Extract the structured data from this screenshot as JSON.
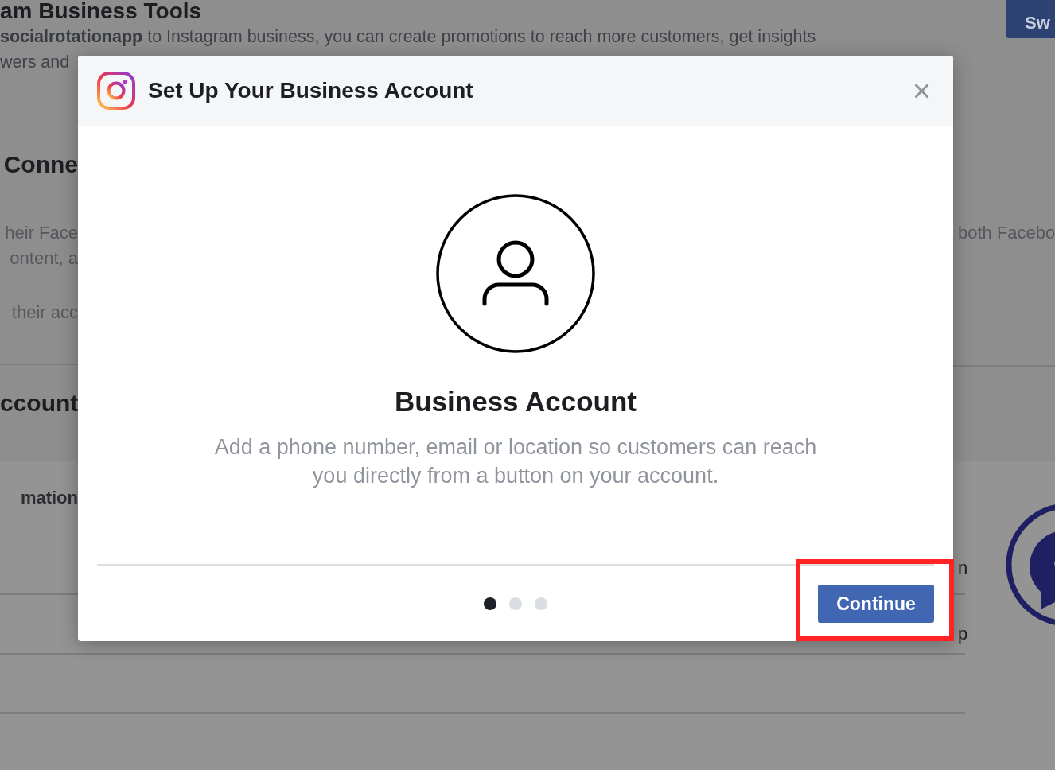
{
  "background": {
    "heading": "am Business Tools",
    "intro": [
      "**socialrotationapp** to Instagram business, you can create promotions to reach more customers, get insights",
      "wers and"
    ],
    "switch_button": "Sw",
    "left_fragments": [
      {
        "kind": "heading",
        "text": "Conne"
      },
      {
        "kind": "text",
        "text": "heir Face"
      },
      {
        "kind": "text",
        "text": "ontent, a"
      },
      {
        "kind": "text",
        "text": "their acc"
      },
      {
        "kind": "heading",
        "text": "ccount"
      },
      {
        "kind": "label",
        "text": "mation"
      }
    ],
    "right_fragments": [
      {
        "kind": "text",
        "text": "both Facebo"
      },
      {
        "kind": "row",
        "text": "n"
      },
      {
        "kind": "row",
        "text": "p"
      }
    ]
  },
  "dialog": {
    "title": "Set Up Your Business Account",
    "close": "×",
    "heading": "Business Account",
    "description": "Add a phone number, email or location so customers can reach you directly from a button on your account.",
    "steps": [
      {
        "selected": true
      },
      {
        "selected": false
      },
      {
        "selected": false
      }
    ],
    "continue_button": "Continue",
    "highlighted": true
  }
}
